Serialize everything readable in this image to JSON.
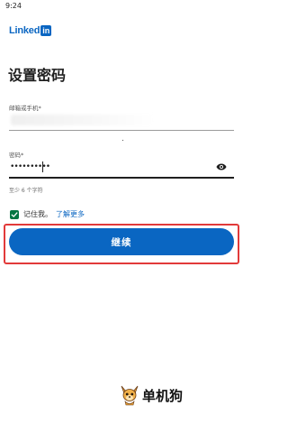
{
  "status_bar": {
    "time": "9:24"
  },
  "logo": {
    "text": "Linked",
    "box": "in"
  },
  "page": {
    "title": "设置密码"
  },
  "email_field": {
    "label": "邮箱或手机*"
  },
  "password_field": {
    "label": "密码*",
    "value": "••••••••••",
    "toggle_icon": "eye-icon"
  },
  "hint": {
    "text": "至少 6 个字符"
  },
  "remember": {
    "label": "记住我。",
    "link": "了解更多",
    "checked": true
  },
  "continue_button": {
    "label": "继续"
  },
  "watermark": {
    "text": "单机狗"
  },
  "colors": {
    "brand_blue": "#0a66c2",
    "checkbox_green": "#057642",
    "highlight_red": "#e23a3a"
  }
}
